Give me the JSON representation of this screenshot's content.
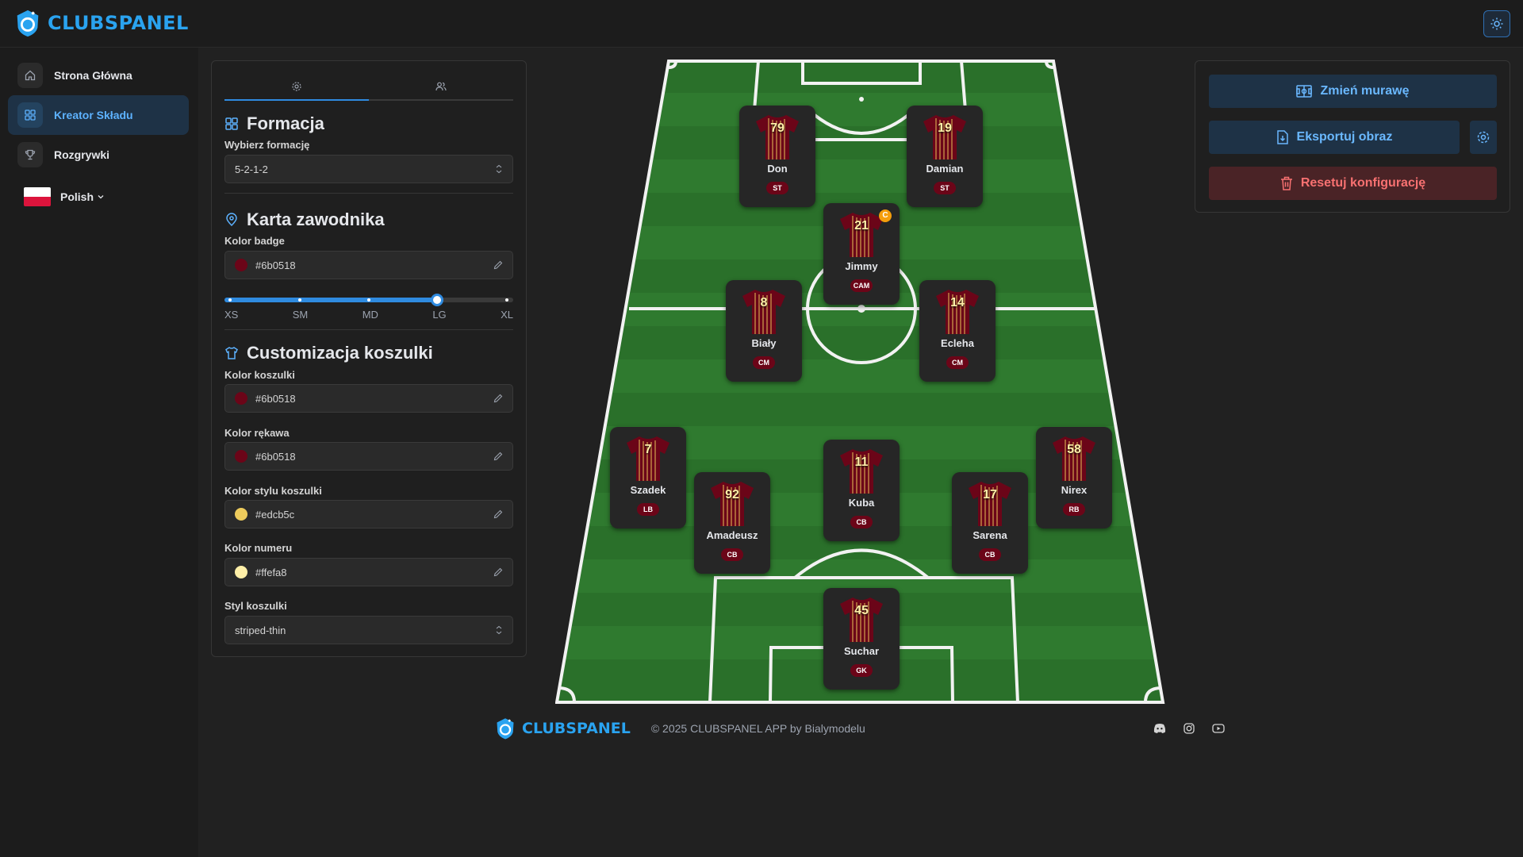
{
  "app": {
    "logo_text": "CLUBSPANEL"
  },
  "sidebar": {
    "items": [
      {
        "label": "Strona Główna",
        "icon": "home-icon"
      },
      {
        "label": "Kreator Składu",
        "icon": "grid-icon"
      },
      {
        "label": "Rozgrywki",
        "icon": "trophy-icon"
      }
    ],
    "language": "Polish"
  },
  "editor": {
    "formation": {
      "title": "Formacja",
      "select_label": "Wybierz formację",
      "value": "5-2-1-2"
    },
    "player_card": {
      "title": "Karta zawodnika",
      "badge_color_label": "Kolor badge",
      "badge_color": "#6b0518",
      "sizes": [
        "XS",
        "SM",
        "MD",
        "LG",
        "XL"
      ],
      "selected_size": "LG"
    },
    "jersey": {
      "title": "Customizacja koszulki",
      "shirt_color_label": "Kolor koszulki",
      "shirt_color": "#6b0518",
      "sleeve_color_label": "Kolor rękawa",
      "sleeve_color": "#6b0518",
      "style_color_label": "Kolor stylu koszulki",
      "style_color": "#edcb5c",
      "number_color_label": "Kolor numeru",
      "number_color": "#ffefa8",
      "style_label": "Styl koszulki",
      "style": "striped-thin"
    }
  },
  "players": [
    {
      "number": "79",
      "name": "Don",
      "position": "ST"
    },
    {
      "number": "19",
      "name": "Damian",
      "position": "ST"
    },
    {
      "number": "21",
      "name": "Jimmy",
      "position": "CAM",
      "captain": "C"
    },
    {
      "number": "8",
      "name": "Biały",
      "position": "CM"
    },
    {
      "number": "14",
      "name": "Ecleha",
      "position": "CM"
    },
    {
      "number": "7",
      "name": "Szadek",
      "position": "LB"
    },
    {
      "number": "92",
      "name": "Amadeusz",
      "position": "CB"
    },
    {
      "number": "11",
      "name": "Kuba",
      "position": "CB"
    },
    {
      "number": "17",
      "name": "Sarena",
      "position": "CB"
    },
    {
      "number": "58",
      "name": "Nirex",
      "position": "RB"
    },
    {
      "number": "45",
      "name": "Suchar",
      "position": "GK"
    }
  ],
  "actions": {
    "change_pitch": "Zmień murawę",
    "export_image": "Eksportuj obraz",
    "reset_config": "Resetuj konfigurację"
  },
  "footer": {
    "logo_text": "CLUBSPANEL",
    "copyright": "© 2025 CLUBSPANEL APP by Bialymodelu",
    "icons": [
      "discord-icon",
      "instagram-icon",
      "youtube-icon"
    ]
  }
}
